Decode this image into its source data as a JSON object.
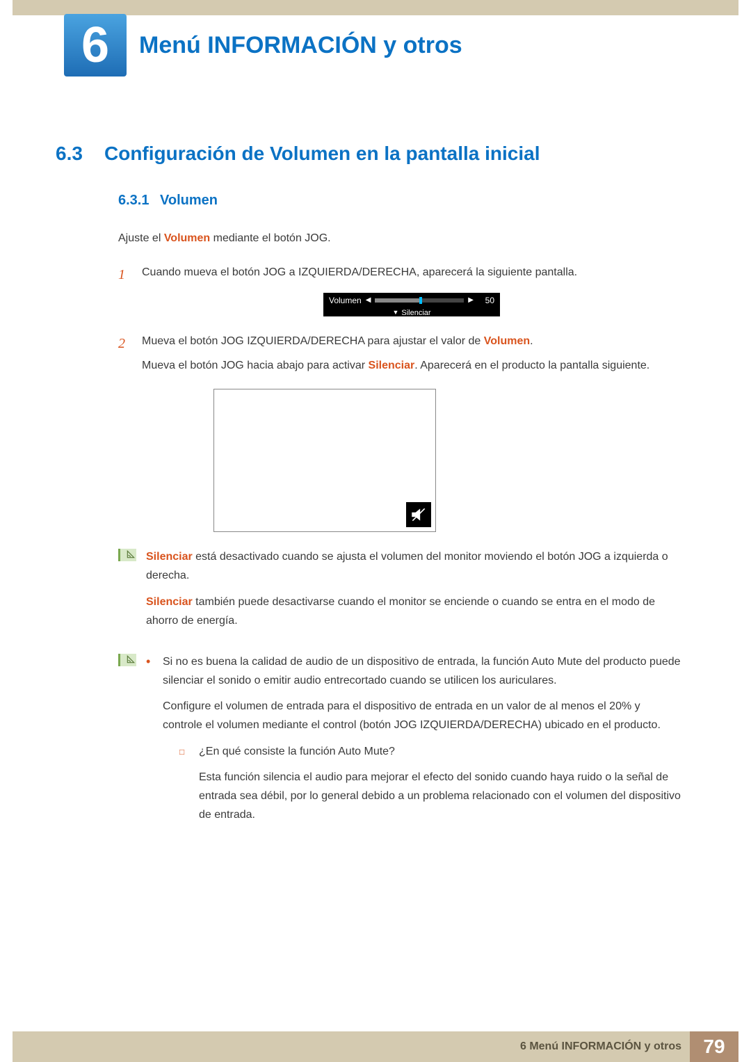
{
  "chapter": {
    "number": "6",
    "title": "Menú INFORMACIÓN y otros"
  },
  "section": {
    "number": "6.3",
    "title": "Configuración de Volumen en la pantalla inicial"
  },
  "subsection": {
    "number": "6.3.1",
    "title": "Volumen"
  },
  "intro": {
    "before": "Ajuste el ",
    "term": "Volumen",
    "after": " mediante el botón JOG."
  },
  "step1": {
    "num": "1",
    "text": "Cuando mueva el botón JOG a IZQUIERDA/DERECHA, aparecerá la siguiente pantalla."
  },
  "osd": {
    "label": "Volumen",
    "value": "50",
    "mute": "Silenciar"
  },
  "step2": {
    "num": "2",
    "p1_before": "Mueva el botón JOG IZQUIERDA/DERECHA para ajustar el valor de ",
    "p1_term": "Volumen",
    "p1_after": ".",
    "p2_before": "Mueva el botón JOG hacia abajo para activar ",
    "p2_term": "Silenciar",
    "p2_after": ". Aparecerá en el producto la pantalla siguiente."
  },
  "note1": {
    "p1_term": "Silenciar",
    "p1_rest": " está desactivado cuando se ajusta el volumen del monitor moviendo el botón JOG a izquierda o derecha.",
    "p2_term": "Silenciar",
    "p2_rest": " también puede desactivarse cuando el monitor se enciende o cuando se entra en el modo de ahorro de energía."
  },
  "note2": {
    "bullet1_p1": "Si no es buena la calidad de audio de un dispositivo de entrada, la función Auto Mute del producto puede silenciar el sonido o emitir audio entrecortado cuando se utilicen los auriculares.",
    "bullet1_p2": "Configure el volumen de entrada para el dispositivo de entrada en un valor de al menos el 20% y controle el volumen mediante el control (botón JOG IZQUIERDA/DERECHA) ubicado en el producto.",
    "sub_q": "¿En qué consiste la función Auto Mute?",
    "sub_a": "Esta función silencia el audio para mejorar el efecto del sonido cuando haya ruido o la señal de entrada sea débil, por lo general debido a un problema relacionado con el volumen del dispositivo de entrada."
  },
  "footer": {
    "label": "6 Menú INFORMACIÓN y otros",
    "page": "79"
  }
}
